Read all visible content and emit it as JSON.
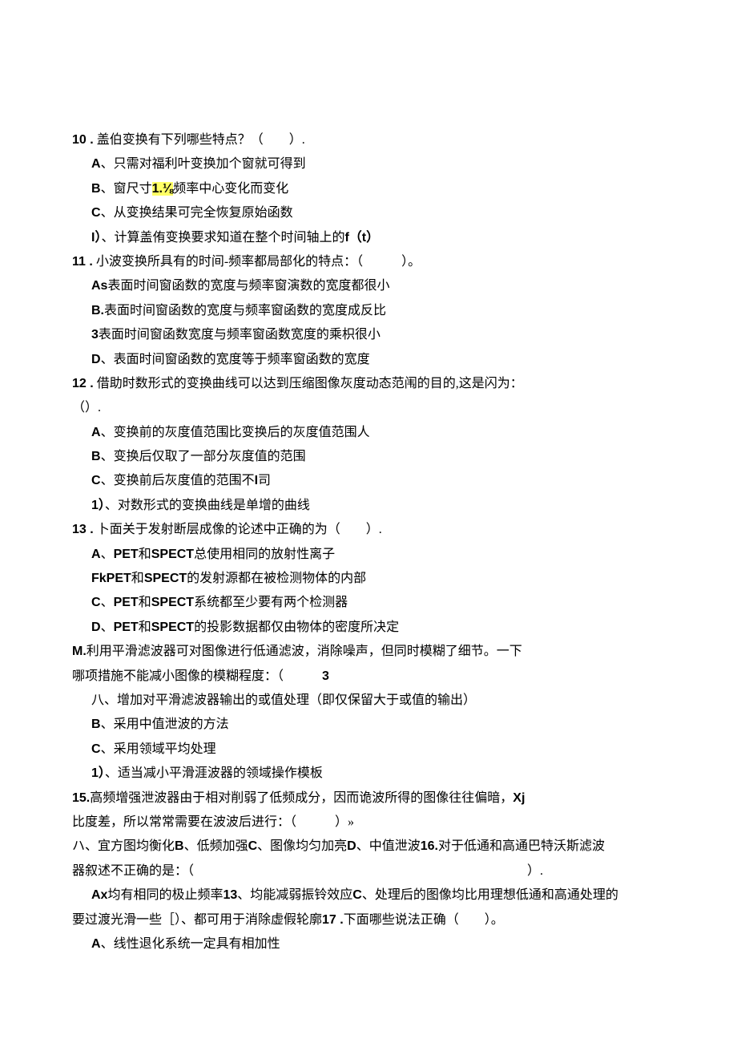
{
  "q10": {
    "stem_num": "10 .",
    "stem_text": "盖伯变换有下列哪些特点？（　　）.",
    "optA_label": "A",
    "optA_text": "、只需对福利叶变换加个窗就可得到",
    "optB_pre": "B",
    "optB_mid1": "、窗尺寸",
    "optB_hl": "1.⅛",
    "optB_mid2": "频率中心变化而变化",
    "optC_label": "C",
    "optC_text": "、从变换结果可完全恢复原始函数",
    "optD_label": "I）",
    "optD_text": "、计算盖侑变换要求知道在整个时间轴上的",
    "optD_tail": "f（t）"
  },
  "q11": {
    "stem_num": "11 .",
    "stem_text": "小波变换所具有的时间-频率都局部化的特点：（　　　）。",
    "optA_label": "As",
    "optA_text": "表面时间窗函数的宽度与频率窗演数的宽度都很小",
    "optB_label": "B.",
    "optB_text": "表面时间窗函数的宽度与频率窗函数的宽度成反比",
    "optC_label": "3",
    "optC_text": "表面时间窗函数宽度与频率窗函数宽度的乘枳很小",
    "optD_label": "D",
    "optD_text": "、表面时间窗函数的宽度等于频率窗函数的宽度"
  },
  "q12": {
    "stem_num": "12 .",
    "stem_text": "借助时数形式的变换曲线可以达到压缩图像灰度动态范闱的目的,这是闪为：",
    "stem_cont": "（）.",
    "optA_label": "A",
    "optA_text": "、变换前的灰度值范围比变换后的灰度值范围人",
    "optB_label": "B",
    "optB_text": "、变换后仅取了一部分灰度值的范围",
    "optC_label": "C",
    "optC_text": "、变换前后灰度值的范围不",
    "optC_tail": "I",
    "optC_tail2": "司",
    "optD_label": "1）",
    "optD_text": "、对数形式的变换曲线是单增的曲线"
  },
  "q13": {
    "stem_num": "13 .",
    "stem_text": "卜面关于发射断层成像的论述中正确的为（　　）.",
    "optA_pre": "A",
    "optA_mid": "、",
    "optA_b1": "PET",
    "optA_t1": "和",
    "optA_b2": "SPECT",
    "optA_t2": "总使用相同的放射性离子",
    "optB_b1": "FkPET",
    "optB_t1": "和",
    "optB_b2": "SPECT",
    "optB_t2": "的发射源都在被检测物体的内部",
    "optC_pre": "C",
    "optC_mid": "、",
    "optC_b1": "PET",
    "optC_t1": "和",
    "optC_b2": "SPECT",
    "optC_t2": "系统都至少要有两个检测器",
    "optD_pre": "D",
    "optD_mid": "、",
    "optD_b1": "PET",
    "optD_t1": "和",
    "optD_b2": "SPECT",
    "optD_t2": "的投影数据都仅由物体的密度所决定"
  },
  "q14": {
    "stem_num": "M.",
    "stem_text": "利用平滑滤波器可对图像进行低通滤波，消除噪声，但同时模糊了细节。一下",
    "stem_cont1": "哪项措施不能减小图像的模糊程度：（　　　",
    "stem_cont2": "3",
    "optA": "八、增加对平滑滤波器输出的或值处理（即仅保留大于或值的输出）",
    "optB_label": "B",
    "optB_text": "、采用中值泄波的方法",
    "optC_label": "C",
    "optC_text": "、采用领域平均处理",
    "optD_label": "1）",
    "optD_text": "、适当减小平滑涯波器的领域操作模板"
  },
  "q15": {
    "stem_num": "15.",
    "stem_text": "高频增强泄波器由于相对削弱了低频成分，因而诡波所得的图像往往偏暗，",
    "stem_tail": "Xj",
    "stem_cont": "比度差，所以常常需要在波波后进行：（　　　）»",
    "opts1": "ハ、宜方图均衡化",
    "opts1b": "B",
    "opts1t": "、低频加强",
    "opts1c": "C",
    "opts1ct": "、图像均匀加亮",
    "opts1d": "D",
    "opts1dt": "、中值泄波"
  },
  "q16": {
    "stem_num": "16.",
    "stem_text": "对于低通和高通巴特沃斯滤波",
    "stem_cont": "器叙述不正确的是：（　　　　　　　　　　　　　　　　　　　　　　　　　　）.",
    "opts_pre": "Ax",
    "opts_t1": "均有相同的极止频率",
    "opts_b1": "13",
    "opts_t2": "、均能减弱振铃效应",
    "opts_c": "C",
    "opts_t3": "、处理后的图像均比用理想低通和高通处理的",
    "opts_cont": "要过渡光滑一些［）、都可用于消除虚假轮廓"
  },
  "q17": {
    "stem_num": "17 .",
    "stem_text": "下面哪些说法正确（　　）。",
    "optA_label": "A",
    "optA_text": "、线性退化系统一定具有相加性"
  }
}
